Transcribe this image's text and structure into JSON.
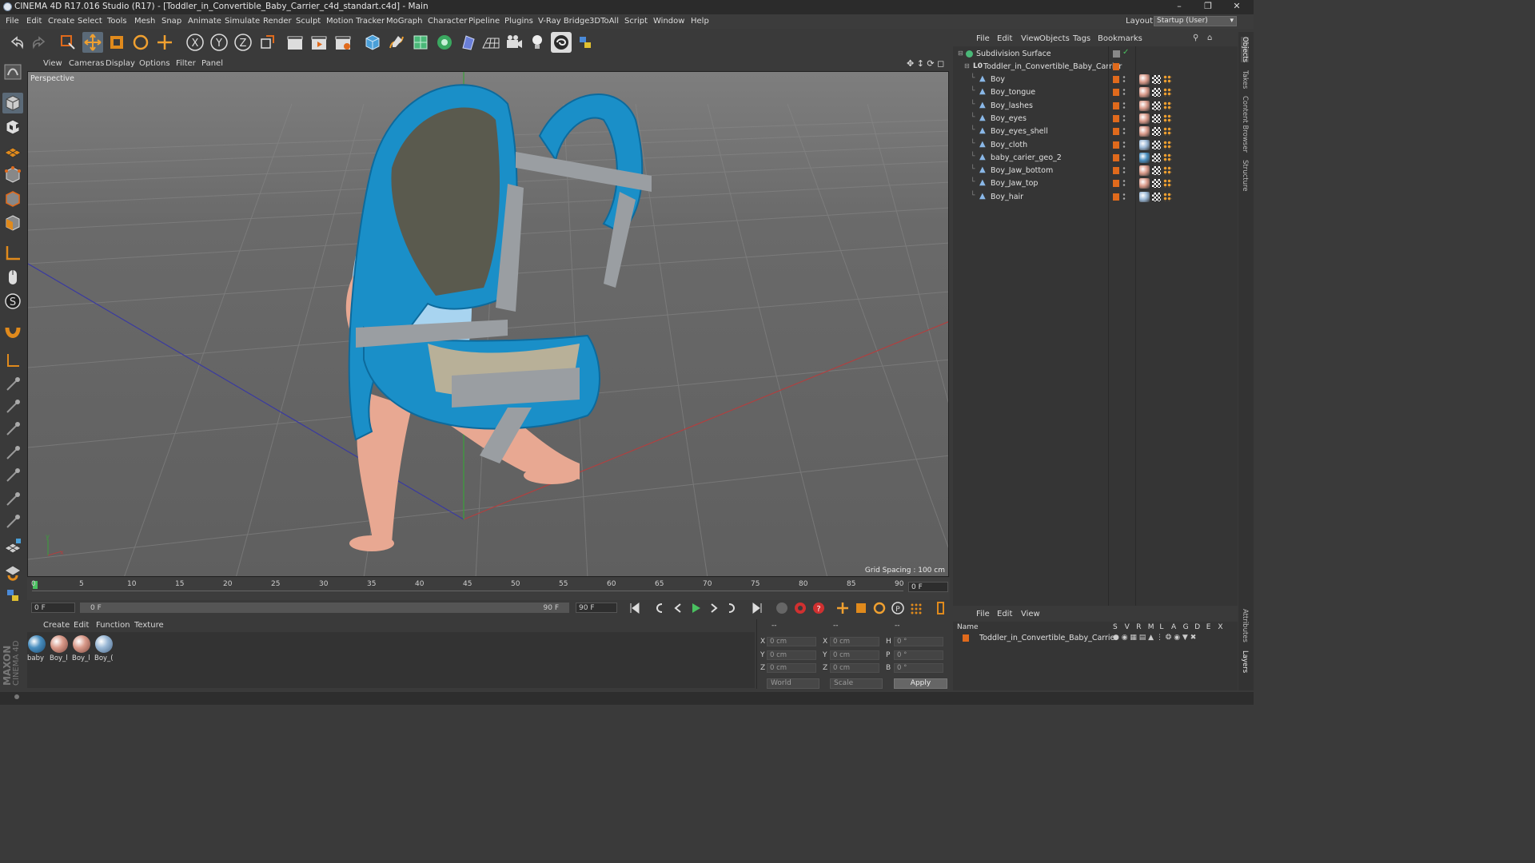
{
  "window": {
    "title": "CINEMA 4D R17.016 Studio (R17) - [Toddler_in_Convertible_Baby_Carrier_c4d_standart.c4d] - Main"
  },
  "menu": [
    "File",
    "Edit",
    "Create",
    "Select",
    "Tools",
    "Mesh",
    "Snap",
    "Animate",
    "Simulate",
    "Render",
    "Sculpt",
    "Motion Tracker",
    "MoGraph",
    "Character",
    "Pipeline",
    "Plugins",
    "V-Ray Bridge",
    "3DToAll",
    "Script",
    "Window",
    "Help"
  ],
  "layout": {
    "label": "Layout:",
    "value": "Startup (User)"
  },
  "viewport": {
    "menu": [
      "View",
      "Cameras",
      "Display",
      "Options",
      "Filter",
      "Panel"
    ],
    "label": "Perspective",
    "grid_spacing": "Grid Spacing : 100 cm"
  },
  "timeline": {
    "ticks": [
      "0",
      "5",
      "10",
      "15",
      "20",
      "25",
      "30",
      "35",
      "40",
      "45",
      "50",
      "55",
      "60",
      "65",
      "70",
      "75",
      "80",
      "85",
      "90"
    ],
    "current_frame": "0 F",
    "start_field": "0 F",
    "range_start": "0 F",
    "range_end": "90 F",
    "end_field": "90 F"
  },
  "materials": {
    "menu": [
      "Create",
      "Edit",
      "Function",
      "Texture"
    ],
    "items": [
      {
        "label": "baby",
        "color": "#4a8fc0"
      },
      {
        "label": "Boy_l",
        "color": "#d99a8a"
      },
      {
        "label": "Boy_l",
        "color": "#d99a8a"
      },
      {
        "label": "Boy_(",
        "color": "#9ab8d6"
      }
    ]
  },
  "coordinates": {
    "header": [
      "--",
      "--",
      "--"
    ],
    "rows": [
      {
        "a": "X",
        "av": "0 cm",
        "b": "X",
        "bv": "0 cm",
        "c": "H",
        "cv": "0 °"
      },
      {
        "a": "Y",
        "av": "0 cm",
        "b": "Y",
        "bv": "0 cm",
        "c": "P",
        "cv": "0 °"
      },
      {
        "a": "Z",
        "av": "0 cm",
        "b": "Z",
        "bv": "0 cm",
        "c": "B",
        "cv": "0 °"
      }
    ],
    "mode": "World",
    "scale": "Scale",
    "apply": "Apply"
  },
  "object_manager": {
    "menu": [
      "File",
      "Edit",
      "View",
      "Objects",
      "Tags",
      "Bookmarks"
    ],
    "root": "Subdivision Surface",
    "group": "Toddler_in_Convertible_Baby_Carrier",
    "objects": [
      "Boy",
      "Boy_tongue",
      "Boy_lashes",
      "Boy_eyes",
      "Boy_eyes_shell",
      "Boy_cloth",
      "baby_carier_geo_2",
      "Boy_Jaw_bottom",
      "Boy_Jaw_top",
      "Boy_hair"
    ],
    "tag_colors": [
      "#d99a8a",
      "#d99a8a",
      "#d99a8a",
      "#d99a8a",
      "#d99a8a",
      "#9ab8d6",
      "#4a8fc0",
      "#d99a8a",
      "#d99a8a",
      "#9ab8d6"
    ]
  },
  "layer_manager": {
    "menu": [
      "File",
      "Edit",
      "View"
    ],
    "header": {
      "name": "Name",
      "flags": [
        "S",
        "V",
        "R",
        "M",
        "L",
        "A",
        "G",
        "D",
        "E",
        "X"
      ]
    },
    "row": "Toddler_in_Convertible_Baby_Carrier"
  },
  "right_tabs": [
    "Objects",
    "Takes",
    "Content Browser",
    "Structure",
    "Attributes",
    "Layers"
  ],
  "brand": {
    "line1": "MAXON",
    "line2": "CINEMA 4D"
  },
  "colors": {
    "accent": "#e06a1c",
    "carrier_blue": "#1a8fc8",
    "strap_gray": "#9a9ea2"
  }
}
